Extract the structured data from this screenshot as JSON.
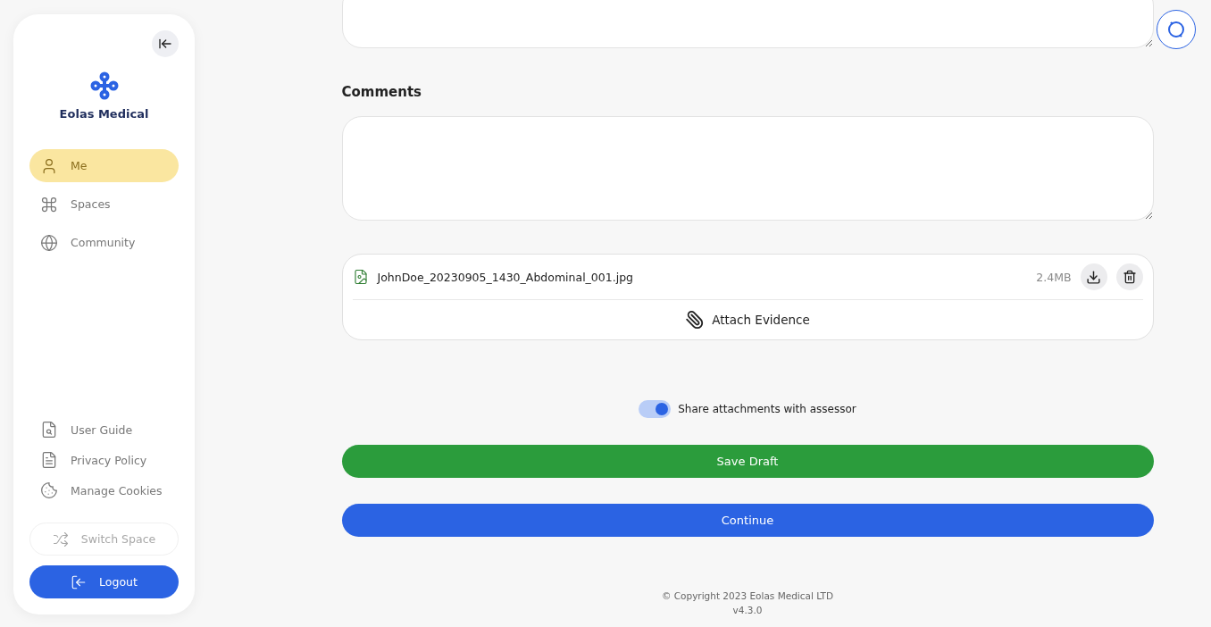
{
  "sidebar": {
    "brand": "Eolas Medical",
    "nav": [
      {
        "label": "Me",
        "kind": "me",
        "selected": true
      },
      {
        "label": "Spaces",
        "kind": "spaces",
        "selected": false
      },
      {
        "label": "Community",
        "kind": "community",
        "selected": false
      }
    ],
    "links": [
      {
        "label": "User Guide",
        "kind": "guide"
      },
      {
        "label": "Privacy Policy",
        "kind": "policy"
      },
      {
        "label": "Manage Cookies",
        "kind": "cookies"
      }
    ],
    "switch_space": {
      "label": "Switch Space",
      "disabled": true
    },
    "logout": {
      "label": "Logout"
    }
  },
  "main": {
    "comments": {
      "label": "Comments"
    },
    "attachment": {
      "file_name": "JohnDoe_20230905_1430_Abdominal_001.jpg",
      "size": "2.4MB",
      "action": "Attach Evidence"
    },
    "share_toggle": {
      "label": "Share attachments with assessor",
      "on": true
    },
    "save_draft": "Save Draft",
    "continue": "Continue",
    "footer": {
      "copyright": "© Copyright 2023 Eolas Medical LTD",
      "version": "v4.3.0"
    }
  }
}
